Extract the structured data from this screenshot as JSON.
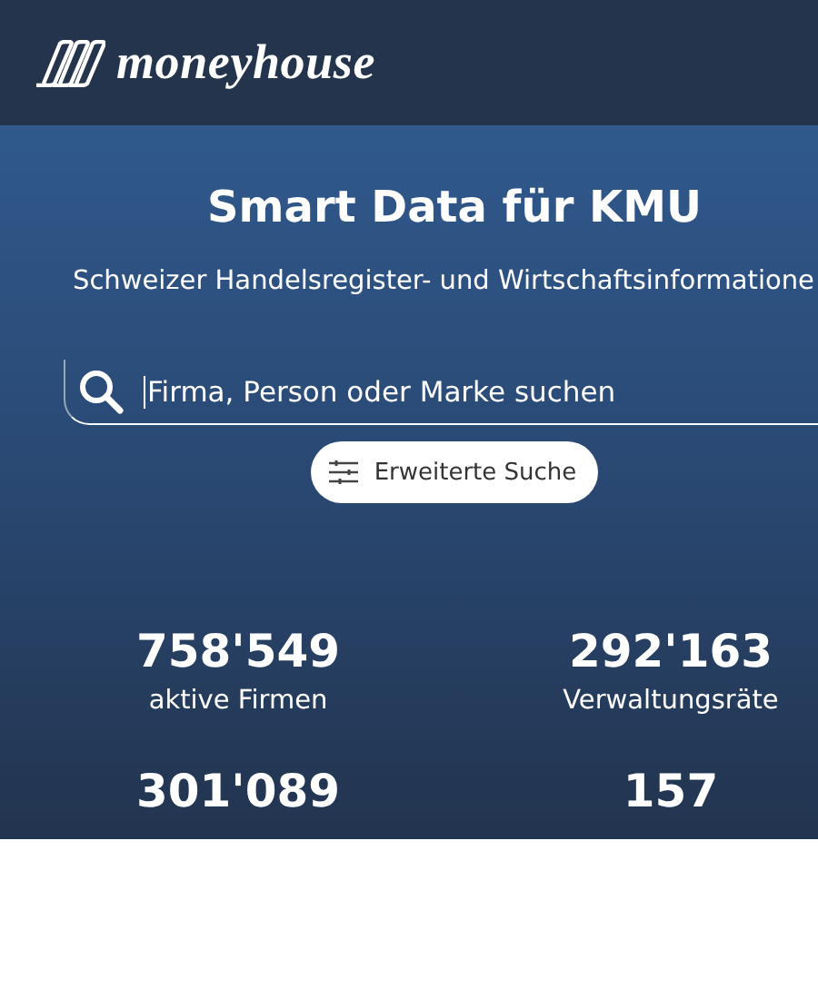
{
  "header": {
    "logo_text": "moneyhouse"
  },
  "hero": {
    "title": "Smart Data für KMU",
    "subtitle": "Schweizer Handelsregister- und Wirtschaftsinformatione",
    "search": {
      "placeholder": "Firma, Person oder Marke suchen"
    },
    "advanced_search_button": "Erweiterte Suche"
  },
  "stats": [
    {
      "value": "758'549",
      "label": "aktive Firmen"
    },
    {
      "value": "292'163",
      "label": "Verwaltungsräte"
    },
    {
      "value": "301'089"
    },
    {
      "value": "157"
    }
  ]
}
